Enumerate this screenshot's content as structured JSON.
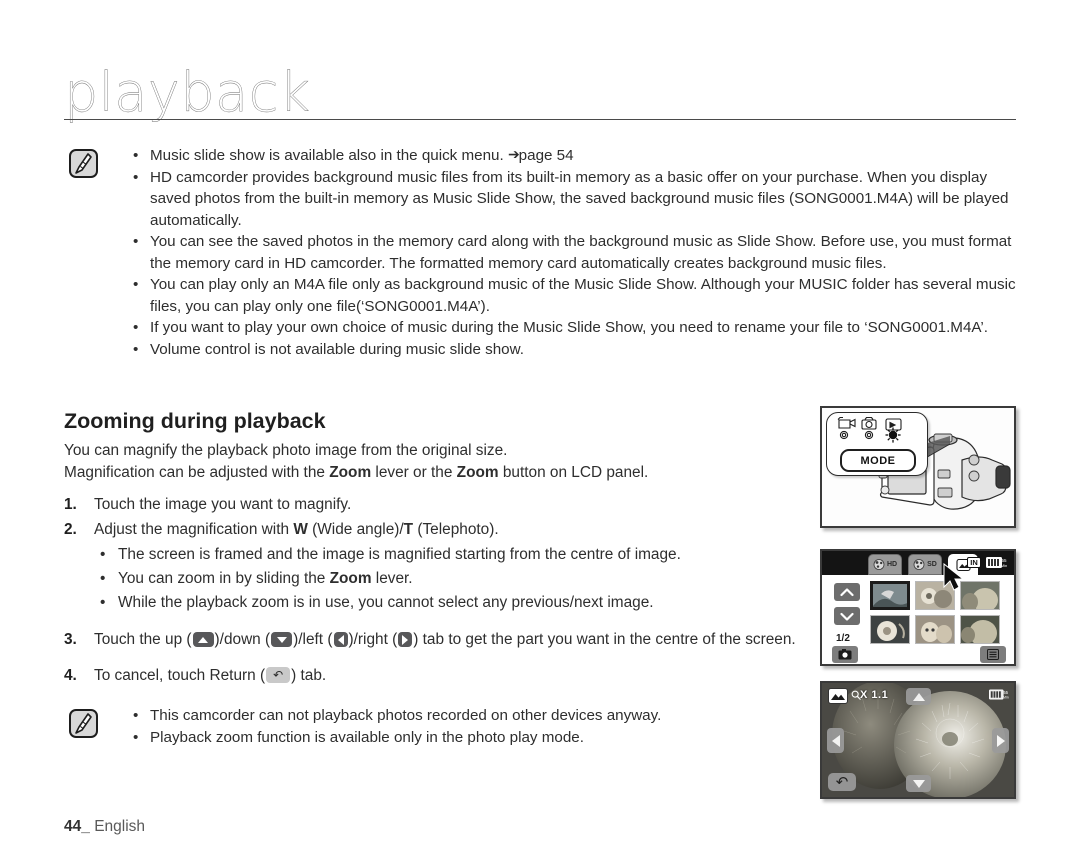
{
  "header": {
    "title": "playback"
  },
  "note_top": {
    "icon_name": "note-pen-icon",
    "items": [
      "Music slide show is available also in the quick menu.",
      "HD camcorder provides background music files from its built-in memory as a basic offer on your purchase. When you display saved photos from the built-in memory as Music Slide Show, the saved background music files (SONG0001.M4A) will be played automatically.",
      "You can see the saved photos in the memory card along with the background music as Slide Show. Before use, you must format the memory card in HD camcorder. The formatted memory card automatically creates background music files.",
      "You can play only an M4A file only as background music of the Music Slide Show. Although your MUSIC folder has several music files, you can play only one file(‘SONG0001.M4A’).",
      "If you want to play your own choice of music during the Music Slide Show, you need to rename your file to ‘SONG0001.M4A’.",
      "Volume control is not available during music slide show."
    ],
    "page_ref": "page 54",
    "page_ref_arrow": "➔"
  },
  "section": {
    "heading": "Zooming during playback",
    "intro_line1": "You can magnify the playback photo image from the original size.",
    "intro_line2_a": "Magnification can be adjusted with the ",
    "intro_line2_zoom1": "Zoom",
    "intro_line2_b": " lever or the ",
    "intro_line2_zoom2": "Zoom",
    "intro_line2_c": " button on LCD panel.",
    "step1_num": "1.",
    "step1_text": "Touch the image you want to magnify.",
    "step2_num": "2.",
    "step2_a": "Adjust the magnification with ",
    "step2_w": "W",
    "step2_b": " (Wide angle)/",
    "step2_t": "T",
    "step2_c": " (Telephoto).",
    "step2_subs": [
      "The screen is framed and the image is magnified starting from the centre of image.",
      "You can zoom in by sliding the Zoom lever.",
      "While the playback zoom is in use, you cannot select any previous/next image."
    ],
    "sub2_a": "You can zoom in by sliding the ",
    "sub2_zoom": "Zoom",
    "sub2_b": " lever.",
    "step3_num": "3.",
    "step3_a": "Touch the up (",
    "step3_b": ")/down (",
    "step3_c": ")/left (",
    "step3_d": ")/right (",
    "step3_e": ") tab to get the part you want in the centre of the screen.",
    "step4_num": "4.",
    "step4_a": "To cancel, touch Return (",
    "step4_b": ") tab."
  },
  "note_bottom": {
    "icon_name": "note-pen-icon",
    "items": [
      "This camcorder can not playback photos recorded on other devices anyway.",
      "Playback zoom function is available only in the photo play mode."
    ]
  },
  "footer": {
    "page_number": "44_",
    "language": "English"
  },
  "illustrations": {
    "camcorder_panel": {
      "mode_button_label": "MODE",
      "mode_icons": [
        "video-camera-icon",
        "photo-camera-icon",
        "play-mode-icon"
      ]
    },
    "thumbnail_panel": {
      "tabs": [
        {
          "label": "HD",
          "icon": "movie-hd-icon",
          "active": false
        },
        {
          "label": "SD",
          "icon": "movie-sd-icon",
          "active": false
        },
        {
          "label": "",
          "icon": "photo-tab-icon",
          "active": true
        }
      ],
      "page_indicator": "1/2",
      "status_icons": [
        "internal-memory-icon",
        "battery-icon"
      ],
      "battery_label_top": "55",
      "battery_label_bottom": "Min",
      "up_arrow": "up-arrow-icon",
      "down_arrow": "down-arrow-icon",
      "capture_button": "photo-capture-icon",
      "menu_button": "menu-list-icon",
      "thumbnails": [
        "thumb-1",
        "thumb-2",
        "thumb-3",
        "thumb-4",
        "thumb-5",
        "thumb-6"
      ]
    },
    "zoom_panel": {
      "magnification_label": "X 1.1",
      "photo_mode_icon": "photo-mode-icon",
      "magnifier_icon": "magnifier-icon",
      "battery_icon": "battery-icon",
      "battery_label_top": "55",
      "battery_label_bottom": "Min",
      "tabs": [
        "up-tab",
        "down-tab",
        "left-tab",
        "right-tab",
        "return-tab"
      ]
    }
  },
  "colors": {
    "title_gray": "#8d8d8d",
    "text": "#2e2e2e",
    "panel_border": "#3a3a3a",
    "tab_gray": "#58585a",
    "tab_light": "#c9c9c9"
  }
}
